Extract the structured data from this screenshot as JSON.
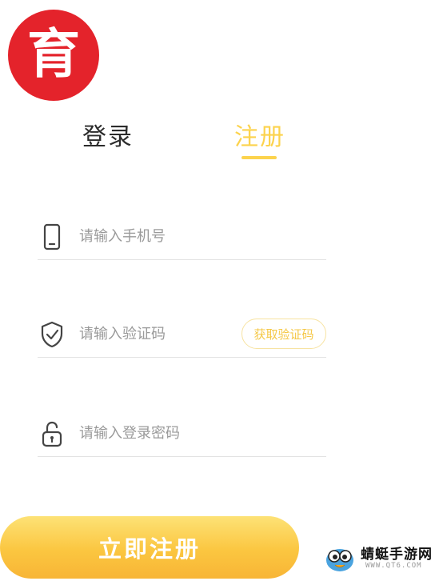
{
  "logo": {
    "glyph": "育"
  },
  "tabs": [
    {
      "label": "登录",
      "active": false
    },
    {
      "label": "注册",
      "active": true
    }
  ],
  "form": {
    "phone": {
      "placeholder": "请输入手机号",
      "value": "",
      "icon": "phone-icon"
    },
    "code": {
      "placeholder": "请输入验证码",
      "value": "",
      "icon": "shield-check-icon",
      "button_label": "获取验证码"
    },
    "password": {
      "placeholder": "请输入登录密码",
      "value": "",
      "icon": "lock-icon"
    }
  },
  "submit": {
    "label": "立即注册"
  },
  "watermark": {
    "title": "蜻蜓手游网",
    "url": "WWW.QT6.COM"
  },
  "colors": {
    "accent": "#fcd34d",
    "brand_red": "#e4232b",
    "button_gradient_top": "#fde276",
    "button_gradient_bottom": "#f8b536"
  }
}
